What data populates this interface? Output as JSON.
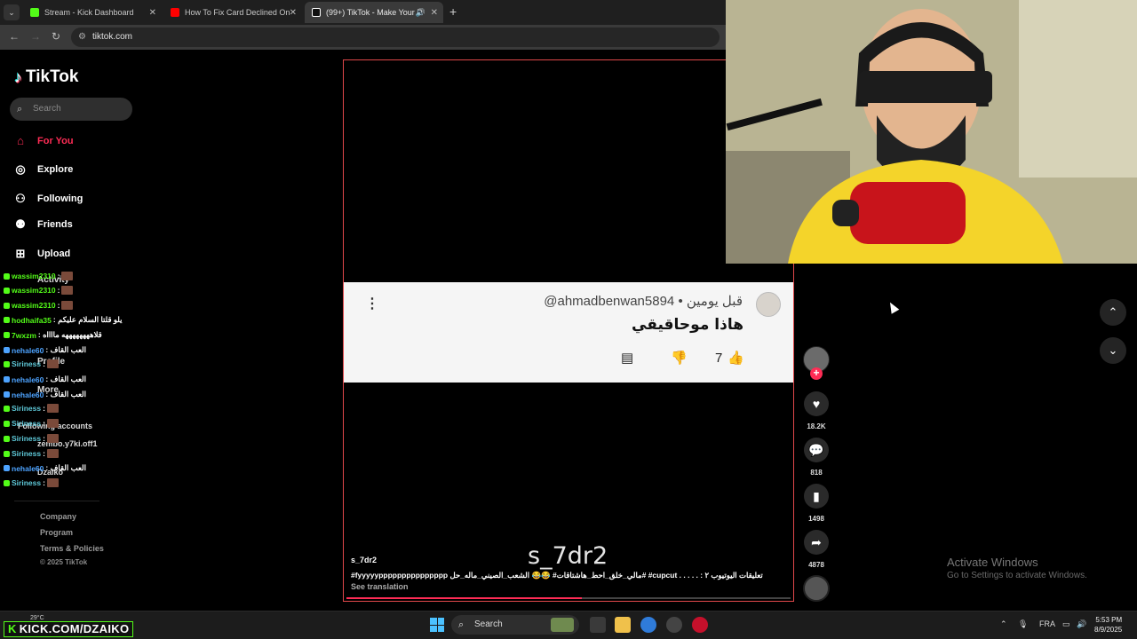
{
  "browser": {
    "tabs": [
      {
        "title": "Stream - Kick Dashboard",
        "favicon_color": "#53fc18"
      },
      {
        "title": "How To Fix Card Declined On E",
        "favicon_color": "#ff0000"
      },
      {
        "title": "(99+) TikTok - Make Your Da",
        "favicon_color": "#ffffff"
      }
    ],
    "url": "tiktok.com"
  },
  "sidebar": {
    "logo": "TikTok",
    "search_placeholder": "Search",
    "nav": [
      {
        "label": "For You",
        "icon": "home-icon"
      },
      {
        "label": "Explore",
        "icon": "compass-icon"
      },
      {
        "label": "Following",
        "icon": "following-icon"
      },
      {
        "label": "Friends",
        "icon": "friends-icon"
      },
      {
        "label": "Upload",
        "icon": "upload-icon"
      },
      {
        "label": "Activity",
        "icon": "activity-icon"
      },
      {
        "label": "Profile",
        "icon": "profile-icon"
      },
      {
        "label": "More",
        "icon": "more-icon"
      }
    ],
    "following_accounts_label": "Following accounts",
    "following_accounts": [
      "zembo.y7ki.off1",
      "Dzaiko"
    ],
    "footer": [
      "Company",
      "Program",
      "Terms & Policies"
    ],
    "copyright": "© 2025 TikTok"
  },
  "chat": [
    {
      "user": "wassim2310",
      "msg": ":",
      "color": "green"
    },
    {
      "user": "wassim2310",
      "msg": ":",
      "color": "green"
    },
    {
      "user": "wassim2310",
      "msg": ":",
      "color": "green"
    },
    {
      "user": "hodhaifa35",
      "msg": ": يلو قلتا السلام عليكم",
      "color": "green"
    },
    {
      "user": "7wxzm",
      "msg": ": قلاههههههههه مااااه",
      "color": "green"
    },
    {
      "user": "nehale60",
      "msg": ": العب القاف",
      "color": "blue"
    },
    {
      "user": "Siriness",
      "msg": ":",
      "color": "teal"
    },
    {
      "user": "nehale60",
      "msg": ": العب القاف",
      "color": "blue"
    },
    {
      "user": "nehale60",
      "msg": ": العب القاف",
      "color": "blue"
    },
    {
      "user": "Siriness",
      "msg": ":",
      "color": "teal"
    },
    {
      "user": "Siriness",
      "msg": ":",
      "color": "teal"
    },
    {
      "user": "Siriness",
      "msg": ":",
      "color": "teal"
    },
    {
      "user": "Siriness",
      "msg": ":",
      "color": "teal"
    },
    {
      "user": "nehale60",
      "msg": ": العب القاف",
      "color": "blue"
    },
    {
      "user": "Siriness",
      "msg": ":",
      "color": "teal"
    }
  ],
  "video": {
    "comment": {
      "handle": "@ahmadbenwan5894 • قبل يومين",
      "text": "هاذا موحاقيقي",
      "likes": "7"
    },
    "watermark": "s_7dr2",
    "author": "s_7dr2",
    "description": "#fyyyyyppppppppppppppp  مالي_خلق_احط_هاشتاقات# 😂😂 الشعب_الصيني_ماله_حل#  #cupcut  . . . . . : تعليقات اليوتيوب ٢",
    "see_translation": "See translation",
    "progress": 0.53
  },
  "actions": {
    "likes": "18.2K",
    "comments": "818",
    "saves": "1498",
    "shares": "4878"
  },
  "windows": {
    "activate_title": "Activate Windows",
    "activate_sub": "Go to Settings to activate Windows."
  },
  "taskbar": {
    "kick_banner": "KICK.COM/DZAIKO",
    "weather": "29°C",
    "search": "Search",
    "lang": "FRA",
    "time": "5:53 PM",
    "date": "8/9/2025"
  }
}
